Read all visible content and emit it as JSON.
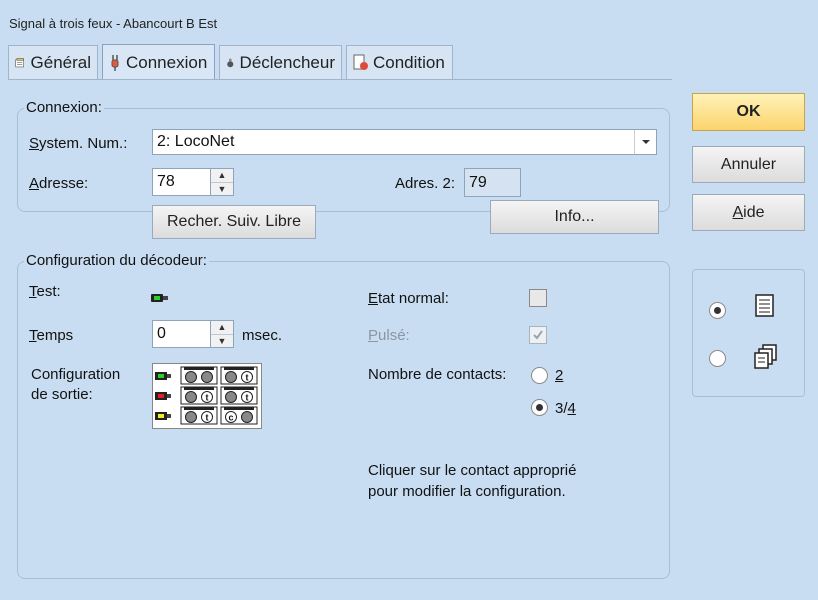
{
  "window": {
    "title": "Signal à trois feux - Abancourt B Est"
  },
  "tabs": [
    {
      "label": "Général"
    },
    {
      "label": "Connexion"
    },
    {
      "label": "Déclencheur"
    },
    {
      "label": "Condition"
    }
  ],
  "connexion": {
    "legend": "Connexion:",
    "system_label_u": "S",
    "system_label_rest": "ystem. Num.:",
    "system_value": "2: LocoNet",
    "adresse_label_u": "A",
    "adresse_label_rest": "dresse:",
    "adresse_value": "78",
    "adres2_label": "Adres. 2:",
    "adres2_value": "79",
    "recher_button": "Recher. Suiv. Libre",
    "info_button": "Info..."
  },
  "decodeur": {
    "legend": "Configuration du décodeur:",
    "test_label_u": "T",
    "test_label_rest": "est:",
    "temps_label_u": "T",
    "temps_label_rest": "emps",
    "temps_value": "0",
    "msec_label": "msec.",
    "config_label_line1": "Configuration",
    "config_label_line2": "de sortie:",
    "etat_label_u": "E",
    "etat_label_rest": "tat normal:",
    "pulse_label_u": "P",
    "pulse_label_rest": "ulsé:",
    "nombre_label": "Nombre de contacts:",
    "option_2": "2",
    "option_34_a": "3/",
    "option_34_b": "4",
    "help_line1": "Cliquer sur le contact approprié",
    "help_line2": "pour modifier la configuration.",
    "config_rows": [
      {
        "lamp": "green",
        "left": [
          "",
          ""
        ],
        "right": [
          "",
          "t"
        ]
      },
      {
        "lamp": "red",
        "left": [
          "",
          "t"
        ],
        "right": [
          "",
          "t"
        ]
      },
      {
        "lamp": "yellow",
        "left": [
          "",
          "t"
        ],
        "right": [
          "c",
          ""
        ]
      }
    ]
  },
  "buttons": {
    "ok": "OK",
    "annuler": "Annuler",
    "aide_u": "A",
    "aide_rest": "ide"
  },
  "colors": {
    "ok_bg": "#fbd46d",
    "green_lamp": "#2bd12b",
    "red_lamp": "#e02020",
    "yellow_lamp": "#f2ee20"
  }
}
